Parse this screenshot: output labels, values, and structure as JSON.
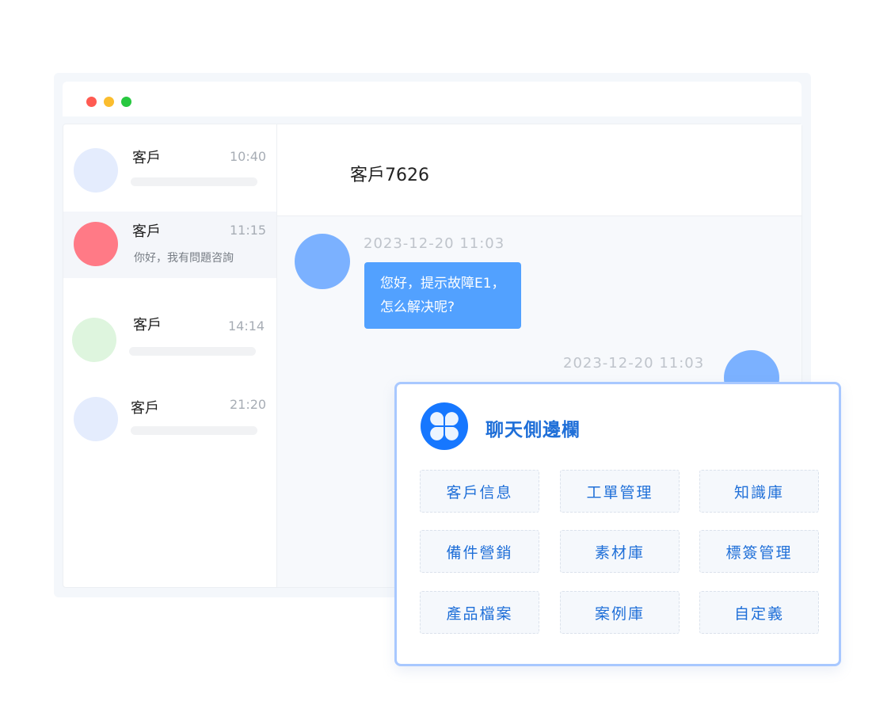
{
  "window": {
    "traffic_lights": [
      "close",
      "minimize",
      "maximize"
    ]
  },
  "conversations": [
    {
      "name": "客戶",
      "time": "10:40",
      "preview": "",
      "avatar_color": "#e4ecfd"
    },
    {
      "name": "客戶",
      "time": "11:15",
      "preview": "你好，我有問題咨詢",
      "avatar_color": "#ff7a86"
    },
    {
      "name": "客戶",
      "time": "14:14",
      "preview": "",
      "avatar_color": "#def5de"
    },
    {
      "name": "客戶",
      "time": "21:20",
      "preview": "",
      "avatar_color": "#e4ecfd"
    }
  ],
  "chat": {
    "title": "客戶7626",
    "messages": [
      {
        "time": "2023-12-20 11:03",
        "lines": [
          "您好，提示故障E1，",
          "怎么解决呢?"
        ]
      },
      {
        "time": "2023-12-20 11:03"
      }
    ]
  },
  "sidebar_panel": {
    "title": "聊天側邊欄",
    "logo_icon": "clover-icon",
    "tiles": [
      "客戶信息",
      "工單管理",
      "知識庫",
      "備件營銷",
      "素材庫",
      "標簽管理",
      "產品檔案",
      "案例庫",
      "自定義"
    ]
  },
  "colors": {
    "accent": "#1677ff",
    "bubble": "#52a1ff",
    "panel_border": "#a8c8ff"
  }
}
